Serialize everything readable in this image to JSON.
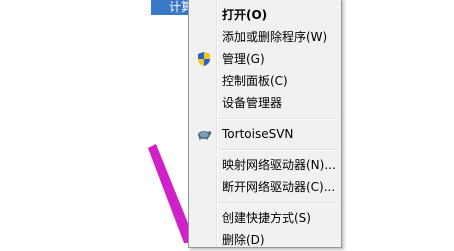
{
  "desktop": {
    "selected_icon_label": "计算机"
  },
  "context_menu": {
    "items": [
      {
        "label": "打开(O)",
        "bold": true
      },
      {
        "label": "添加或删除程序(W)"
      },
      {
        "label": "管理(G)",
        "icon": "uac-shield-icon"
      },
      {
        "label": "控制面板(C)"
      },
      {
        "label": "设备管理器"
      },
      {
        "label": "TortoiseSVN",
        "icon": "tortoise-icon"
      },
      {
        "label": "映射网络驱动器(N)..."
      },
      {
        "label": "断开网络驱动器(C)..."
      },
      {
        "label": "创建快捷方式(S)"
      },
      {
        "label": "删除(D)"
      }
    ]
  },
  "colors": {
    "menu_bg": "#f1f1f1",
    "menu_border": "#979797",
    "selection_blue": "#3a78c8",
    "arrow_magenta": "#d020c8"
  }
}
